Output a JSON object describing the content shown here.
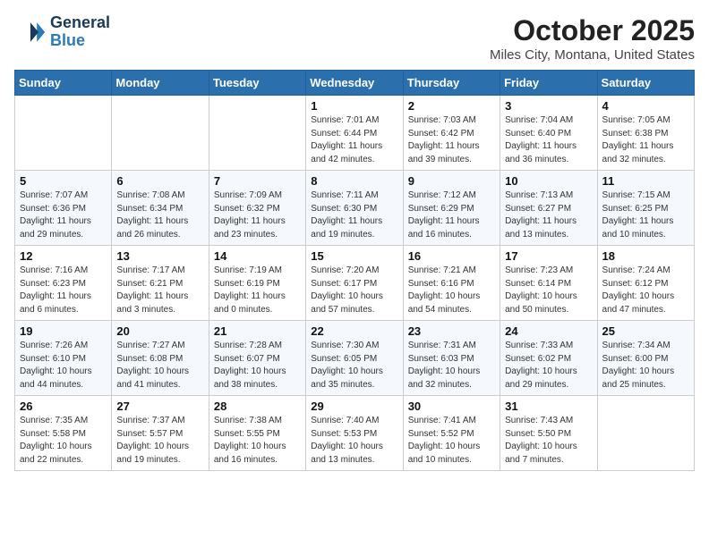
{
  "header": {
    "logo_line1": "General",
    "logo_line2": "Blue",
    "month": "October 2025",
    "location": "Miles City, Montana, United States"
  },
  "weekdays": [
    "Sunday",
    "Monday",
    "Tuesday",
    "Wednesday",
    "Thursday",
    "Friday",
    "Saturday"
  ],
  "weeks": [
    [
      {
        "day": "",
        "info": ""
      },
      {
        "day": "",
        "info": ""
      },
      {
        "day": "",
        "info": ""
      },
      {
        "day": "1",
        "info": "Sunrise: 7:01 AM\nSunset: 6:44 PM\nDaylight: 11 hours and 42 minutes."
      },
      {
        "day": "2",
        "info": "Sunrise: 7:03 AM\nSunset: 6:42 PM\nDaylight: 11 hours and 39 minutes."
      },
      {
        "day": "3",
        "info": "Sunrise: 7:04 AM\nSunset: 6:40 PM\nDaylight: 11 hours and 36 minutes."
      },
      {
        "day": "4",
        "info": "Sunrise: 7:05 AM\nSunset: 6:38 PM\nDaylight: 11 hours and 32 minutes."
      }
    ],
    [
      {
        "day": "5",
        "info": "Sunrise: 7:07 AM\nSunset: 6:36 PM\nDaylight: 11 hours and 29 minutes."
      },
      {
        "day": "6",
        "info": "Sunrise: 7:08 AM\nSunset: 6:34 PM\nDaylight: 11 hours and 26 minutes."
      },
      {
        "day": "7",
        "info": "Sunrise: 7:09 AM\nSunset: 6:32 PM\nDaylight: 11 hours and 23 minutes."
      },
      {
        "day": "8",
        "info": "Sunrise: 7:11 AM\nSunset: 6:30 PM\nDaylight: 11 hours and 19 minutes."
      },
      {
        "day": "9",
        "info": "Sunrise: 7:12 AM\nSunset: 6:29 PM\nDaylight: 11 hours and 16 minutes."
      },
      {
        "day": "10",
        "info": "Sunrise: 7:13 AM\nSunset: 6:27 PM\nDaylight: 11 hours and 13 minutes."
      },
      {
        "day": "11",
        "info": "Sunrise: 7:15 AM\nSunset: 6:25 PM\nDaylight: 11 hours and 10 minutes."
      }
    ],
    [
      {
        "day": "12",
        "info": "Sunrise: 7:16 AM\nSunset: 6:23 PM\nDaylight: 11 hours and 6 minutes."
      },
      {
        "day": "13",
        "info": "Sunrise: 7:17 AM\nSunset: 6:21 PM\nDaylight: 11 hours and 3 minutes."
      },
      {
        "day": "14",
        "info": "Sunrise: 7:19 AM\nSunset: 6:19 PM\nDaylight: 11 hours and 0 minutes."
      },
      {
        "day": "15",
        "info": "Sunrise: 7:20 AM\nSunset: 6:17 PM\nDaylight: 10 hours and 57 minutes."
      },
      {
        "day": "16",
        "info": "Sunrise: 7:21 AM\nSunset: 6:16 PM\nDaylight: 10 hours and 54 minutes."
      },
      {
        "day": "17",
        "info": "Sunrise: 7:23 AM\nSunset: 6:14 PM\nDaylight: 10 hours and 50 minutes."
      },
      {
        "day": "18",
        "info": "Sunrise: 7:24 AM\nSunset: 6:12 PM\nDaylight: 10 hours and 47 minutes."
      }
    ],
    [
      {
        "day": "19",
        "info": "Sunrise: 7:26 AM\nSunset: 6:10 PM\nDaylight: 10 hours and 44 minutes."
      },
      {
        "day": "20",
        "info": "Sunrise: 7:27 AM\nSunset: 6:08 PM\nDaylight: 10 hours and 41 minutes."
      },
      {
        "day": "21",
        "info": "Sunrise: 7:28 AM\nSunset: 6:07 PM\nDaylight: 10 hours and 38 minutes."
      },
      {
        "day": "22",
        "info": "Sunrise: 7:30 AM\nSunset: 6:05 PM\nDaylight: 10 hours and 35 minutes."
      },
      {
        "day": "23",
        "info": "Sunrise: 7:31 AM\nSunset: 6:03 PM\nDaylight: 10 hours and 32 minutes."
      },
      {
        "day": "24",
        "info": "Sunrise: 7:33 AM\nSunset: 6:02 PM\nDaylight: 10 hours and 29 minutes."
      },
      {
        "day": "25",
        "info": "Sunrise: 7:34 AM\nSunset: 6:00 PM\nDaylight: 10 hours and 25 minutes."
      }
    ],
    [
      {
        "day": "26",
        "info": "Sunrise: 7:35 AM\nSunset: 5:58 PM\nDaylight: 10 hours and 22 minutes."
      },
      {
        "day": "27",
        "info": "Sunrise: 7:37 AM\nSunset: 5:57 PM\nDaylight: 10 hours and 19 minutes."
      },
      {
        "day": "28",
        "info": "Sunrise: 7:38 AM\nSunset: 5:55 PM\nDaylight: 10 hours and 16 minutes."
      },
      {
        "day": "29",
        "info": "Sunrise: 7:40 AM\nSunset: 5:53 PM\nDaylight: 10 hours and 13 minutes."
      },
      {
        "day": "30",
        "info": "Sunrise: 7:41 AM\nSunset: 5:52 PM\nDaylight: 10 hours and 10 minutes."
      },
      {
        "day": "31",
        "info": "Sunrise: 7:43 AM\nSunset: 5:50 PM\nDaylight: 10 hours and 7 minutes."
      },
      {
        "day": "",
        "info": ""
      }
    ]
  ]
}
